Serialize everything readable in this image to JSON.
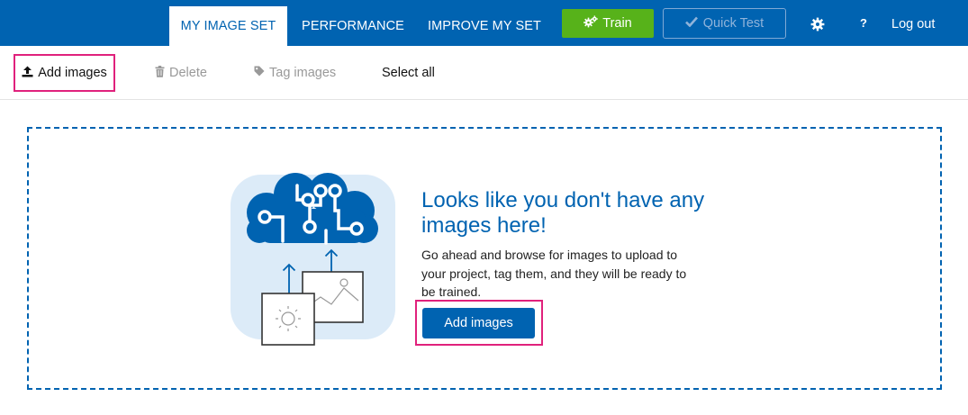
{
  "nav": {
    "tabs": [
      {
        "label": "MY IMAGE SET",
        "active": true
      },
      {
        "label": "PERFORMANCE",
        "active": false
      },
      {
        "label": "IMPROVE MY SET",
        "active": false
      }
    ],
    "train_label": "Train",
    "train_icon": "gears-icon",
    "quick_test_label": "Quick Test",
    "quick_test_icon": "checkmark-icon",
    "settings_icon": "gear-icon",
    "help_label": "?",
    "logout_label": "Log out"
  },
  "toolbar": {
    "add_images_label": "Add images",
    "add_images_icon": "upload-icon",
    "delete_label": "Delete",
    "delete_icon": "trash-icon",
    "tag_images_label": "Tag images",
    "tag_images_icon": "tag-icon",
    "select_all_label": "Select all"
  },
  "empty_state": {
    "title": "Looks like you don't have any images here!",
    "description": "Go ahead and browse for images to upload to your project, tag them, and they will be ready to be trained.",
    "button_label": "Add images"
  },
  "colors": {
    "brand_blue": "#0063b1",
    "train_green": "#57b21a",
    "highlight_pink": "#e0217c",
    "illustration_bg": "#dcebf8"
  }
}
